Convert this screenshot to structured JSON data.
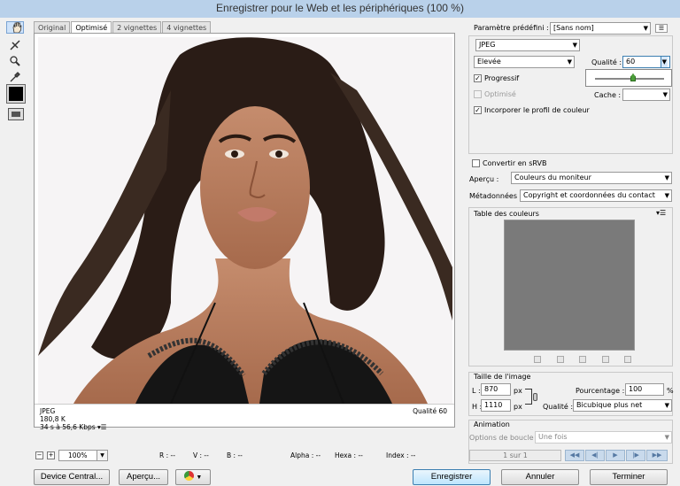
{
  "window": {
    "title": "Enregistrer pour le Web et les périphériques (100 %)"
  },
  "tools": [
    {
      "name": "hand-tool",
      "icon": "hand-icon"
    },
    {
      "name": "slice-select-tool",
      "icon": "slice-select-icon"
    },
    {
      "name": "zoom-tool",
      "icon": "magnifier-icon"
    },
    {
      "name": "eyedropper-tool",
      "icon": "eyedropper-icon"
    }
  ],
  "tabs": [
    "Original",
    "Optimisé",
    "2 vignettes",
    "4 vignettes"
  ],
  "active_tab": "Optimisé",
  "preview": {
    "format": "JPEG",
    "size": "180,8 K",
    "time": "34 s à 56,6 Kbps",
    "quality_label": "Qualité 60"
  },
  "status": {
    "zoom": "100%",
    "r": "R : --",
    "v": "V : --",
    "b": "B : --",
    "alpha": "Alpha : --",
    "hexa": "Hexa : --",
    "index": "Index : --"
  },
  "buttons": {
    "device_central": "Device Central...",
    "apercu": "Aperçu...",
    "save": "Enregistrer",
    "cancel": "Annuler",
    "done": "Terminer"
  },
  "settings": {
    "preset_label": "Paramètre prédéfini :",
    "preset_value": "[Sans nom]",
    "format": "JPEG",
    "compression": "Elevée",
    "quality_label": "Qualité :",
    "quality_value": "60",
    "progressive_label": "Progressif",
    "progressive": true,
    "optimized_label": "Optimisé",
    "optimized": false,
    "blur_label": "Cache :",
    "blur_value": "",
    "embed_profile_label": "Incorporer le profil de couleur",
    "embed_profile": true,
    "srgb_label": "Convertir en sRVB",
    "srgb": false,
    "preview_label": "Aperçu :",
    "preview_value": "Couleurs du moniteur",
    "metadata_label": "Métadonnées :",
    "metadata_value": "Copyright et coordonnées du contact"
  },
  "color_table": {
    "title": "Table des couleurs"
  },
  "image_size": {
    "title": "Taille de l'image",
    "w_label": "L :",
    "w_value": "870",
    "h_label": "H :",
    "h_value": "1110",
    "unit": "px",
    "percent_label": "Pourcentage :",
    "percent_value": "100",
    "percent_unit": "%",
    "quality_label": "Qualité :",
    "quality_value": "Bicubique plus net"
  },
  "animation": {
    "title": "Animation",
    "loop_label": "Options de boucle :",
    "loop_value": "Une fois",
    "frame": "1 sur 1"
  },
  "colors": {
    "accent": "#3c7fb1",
    "titlebar": "#b9d1ea"
  }
}
